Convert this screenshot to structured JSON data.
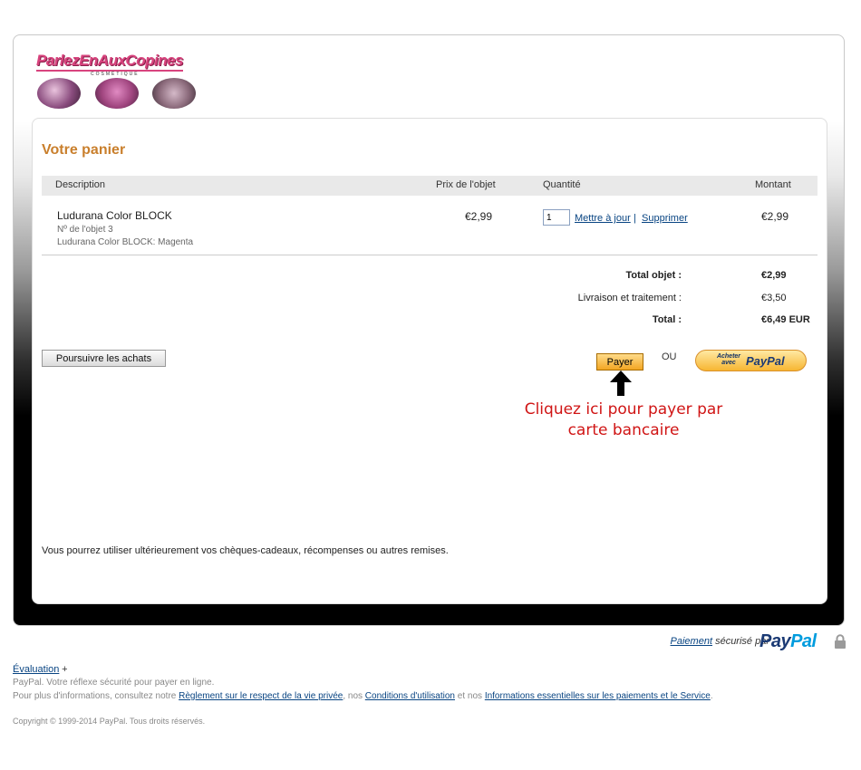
{
  "logo": {
    "text": "ParlezEnAuxCopines",
    "sub": "COSMÉTIQUE"
  },
  "cart": {
    "title": "Votre panier",
    "columns": {
      "description": "Description",
      "price": "Prix de l'objet",
      "quantity": "Quantité",
      "amount": "Montant"
    },
    "item": {
      "name": "Ludurana Color BLOCK",
      "number": "Nº de l'objet 3",
      "option": "Ludurana Color BLOCK: Magenta",
      "price": "€2,99",
      "quantity": "1",
      "amount": "€2,99",
      "update_label": "Mettre à jour",
      "separator": "|",
      "remove_label": "Supprimer"
    },
    "totals": {
      "items_label": "Total objet :",
      "items_value": "€2,99",
      "shipping_label": "Livraison et traitement :",
      "shipping_value": "€3,50",
      "total_label": "Total :",
      "total_value": "€6,49 EUR"
    }
  },
  "actions": {
    "continue_label": "Poursuivre les achats",
    "pay_label": "Payer",
    "or_label": "OU",
    "paypal_small": "Acheter avec",
    "paypal_logo": "PayPal"
  },
  "annotation": {
    "line1": "Cliquez ici pour payer par",
    "line2": "carte bancaire"
  },
  "gift_note": "Vous pourrez utiliser ultérieurement vos chèques-cadeaux, récompenses ou autres remises.",
  "secure": {
    "link": "Paiement",
    "text": " sécurisé par ",
    "logo_pay": "Pay",
    "logo_pal": "Pal"
  },
  "footer": {
    "evaluation": "Évaluation",
    "plus": "+",
    "tagline": "PayPal. Votre réflexe sécurité pour payer en ligne.",
    "info_prefix": "Pour plus d'informations, consultez notre ",
    "privacy_link": "Règlement sur le respect de la vie privée",
    "info_mid1": ", nos ",
    "terms_link": "Conditions d'utilisation",
    "info_mid2": " et nos ",
    "payments_link": "Informations essentielles sur les paiements et le Service",
    "info_end": ".",
    "copyright": "Copyright © 1999-2014 PayPal. Tous droits réservés."
  },
  "colors": {
    "accent": "#c97f2c",
    "link": "#084482",
    "annotation": "#d01515",
    "paypal_dark": "#1b3a74",
    "paypal_light": "#009cde"
  }
}
